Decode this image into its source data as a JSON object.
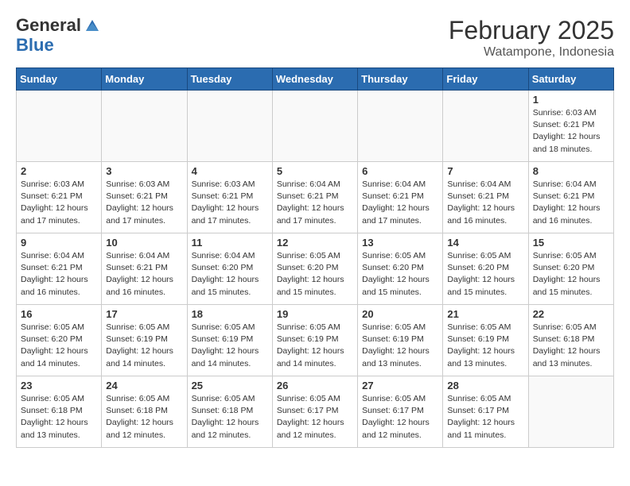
{
  "logo": {
    "general": "General",
    "blue": "Blue"
  },
  "title": "February 2025",
  "subtitle": "Watampone, Indonesia",
  "weekdays": [
    "Sunday",
    "Monday",
    "Tuesday",
    "Wednesday",
    "Thursday",
    "Friday",
    "Saturday"
  ],
  "weeks": [
    [
      {
        "day": "",
        "info": ""
      },
      {
        "day": "",
        "info": ""
      },
      {
        "day": "",
        "info": ""
      },
      {
        "day": "",
        "info": ""
      },
      {
        "day": "",
        "info": ""
      },
      {
        "day": "",
        "info": ""
      },
      {
        "day": "1",
        "info": "Sunrise: 6:03 AM\nSunset: 6:21 PM\nDaylight: 12 hours\nand 18 minutes."
      }
    ],
    [
      {
        "day": "2",
        "info": "Sunrise: 6:03 AM\nSunset: 6:21 PM\nDaylight: 12 hours\nand 17 minutes."
      },
      {
        "day": "3",
        "info": "Sunrise: 6:03 AM\nSunset: 6:21 PM\nDaylight: 12 hours\nand 17 minutes."
      },
      {
        "day": "4",
        "info": "Sunrise: 6:03 AM\nSunset: 6:21 PM\nDaylight: 12 hours\nand 17 minutes."
      },
      {
        "day": "5",
        "info": "Sunrise: 6:04 AM\nSunset: 6:21 PM\nDaylight: 12 hours\nand 17 minutes."
      },
      {
        "day": "6",
        "info": "Sunrise: 6:04 AM\nSunset: 6:21 PM\nDaylight: 12 hours\nand 17 minutes."
      },
      {
        "day": "7",
        "info": "Sunrise: 6:04 AM\nSunset: 6:21 PM\nDaylight: 12 hours\nand 16 minutes."
      },
      {
        "day": "8",
        "info": "Sunrise: 6:04 AM\nSunset: 6:21 PM\nDaylight: 12 hours\nand 16 minutes."
      }
    ],
    [
      {
        "day": "9",
        "info": "Sunrise: 6:04 AM\nSunset: 6:21 PM\nDaylight: 12 hours\nand 16 minutes."
      },
      {
        "day": "10",
        "info": "Sunrise: 6:04 AM\nSunset: 6:21 PM\nDaylight: 12 hours\nand 16 minutes."
      },
      {
        "day": "11",
        "info": "Sunrise: 6:04 AM\nSunset: 6:20 PM\nDaylight: 12 hours\nand 15 minutes."
      },
      {
        "day": "12",
        "info": "Sunrise: 6:05 AM\nSunset: 6:20 PM\nDaylight: 12 hours\nand 15 minutes."
      },
      {
        "day": "13",
        "info": "Sunrise: 6:05 AM\nSunset: 6:20 PM\nDaylight: 12 hours\nand 15 minutes."
      },
      {
        "day": "14",
        "info": "Sunrise: 6:05 AM\nSunset: 6:20 PM\nDaylight: 12 hours\nand 15 minutes."
      },
      {
        "day": "15",
        "info": "Sunrise: 6:05 AM\nSunset: 6:20 PM\nDaylight: 12 hours\nand 15 minutes."
      }
    ],
    [
      {
        "day": "16",
        "info": "Sunrise: 6:05 AM\nSunset: 6:20 PM\nDaylight: 12 hours\nand 14 minutes."
      },
      {
        "day": "17",
        "info": "Sunrise: 6:05 AM\nSunset: 6:19 PM\nDaylight: 12 hours\nand 14 minutes."
      },
      {
        "day": "18",
        "info": "Sunrise: 6:05 AM\nSunset: 6:19 PM\nDaylight: 12 hours\nand 14 minutes."
      },
      {
        "day": "19",
        "info": "Sunrise: 6:05 AM\nSunset: 6:19 PM\nDaylight: 12 hours\nand 14 minutes."
      },
      {
        "day": "20",
        "info": "Sunrise: 6:05 AM\nSunset: 6:19 PM\nDaylight: 12 hours\nand 13 minutes."
      },
      {
        "day": "21",
        "info": "Sunrise: 6:05 AM\nSunset: 6:19 PM\nDaylight: 12 hours\nand 13 minutes."
      },
      {
        "day": "22",
        "info": "Sunrise: 6:05 AM\nSunset: 6:18 PM\nDaylight: 12 hours\nand 13 minutes."
      }
    ],
    [
      {
        "day": "23",
        "info": "Sunrise: 6:05 AM\nSunset: 6:18 PM\nDaylight: 12 hours\nand 13 minutes."
      },
      {
        "day": "24",
        "info": "Sunrise: 6:05 AM\nSunset: 6:18 PM\nDaylight: 12 hours\nand 12 minutes."
      },
      {
        "day": "25",
        "info": "Sunrise: 6:05 AM\nSunset: 6:18 PM\nDaylight: 12 hours\nand 12 minutes."
      },
      {
        "day": "26",
        "info": "Sunrise: 6:05 AM\nSunset: 6:17 PM\nDaylight: 12 hours\nand 12 minutes."
      },
      {
        "day": "27",
        "info": "Sunrise: 6:05 AM\nSunset: 6:17 PM\nDaylight: 12 hours\nand 12 minutes."
      },
      {
        "day": "28",
        "info": "Sunrise: 6:05 AM\nSunset: 6:17 PM\nDaylight: 12 hours\nand 11 minutes."
      },
      {
        "day": "",
        "info": ""
      }
    ]
  ]
}
